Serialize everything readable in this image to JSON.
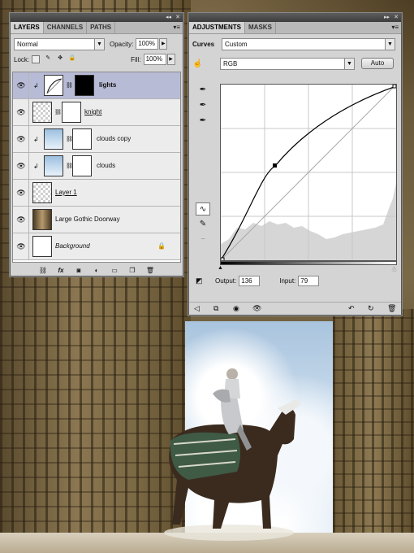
{
  "layers_panel": {
    "tabs": [
      "LAYERS",
      "CHANNELS",
      "PATHS"
    ],
    "blend_mode": "Normal",
    "opacity_label": "Opacity:",
    "opacity_value": "100%",
    "lock_label": "Lock:",
    "fill_label": "Fill:",
    "fill_value": "100%",
    "layers": [
      {
        "name": "lights",
        "selected": true
      },
      {
        "name": "knight",
        "selected": false
      },
      {
        "name": "clouds copy",
        "selected": false
      },
      {
        "name": "clouds",
        "selected": false
      },
      {
        "name": "Layer 1",
        "selected": false
      },
      {
        "name": "Large Gothic Doorway",
        "selected": false
      },
      {
        "name": "Background",
        "selected": false
      }
    ]
  },
  "adjustments_panel": {
    "tabs": [
      "ADJUSTMENTS",
      "MASKS"
    ],
    "adjustment_type": "Curves",
    "preset": "Custom",
    "channel": "RGB",
    "auto_label": "Auto",
    "output_label": "Output:",
    "output_value": "136",
    "input_label": "Input:",
    "input_value": "79"
  },
  "icons": {
    "eye": "eye-icon",
    "link": "link-icon",
    "fx": "fx-icon",
    "mask": "mask-icon",
    "adjustment": "adjustment-layer-icon",
    "folder": "folder-icon",
    "new_layer": "new-layer-icon",
    "trash": "trash-icon"
  }
}
